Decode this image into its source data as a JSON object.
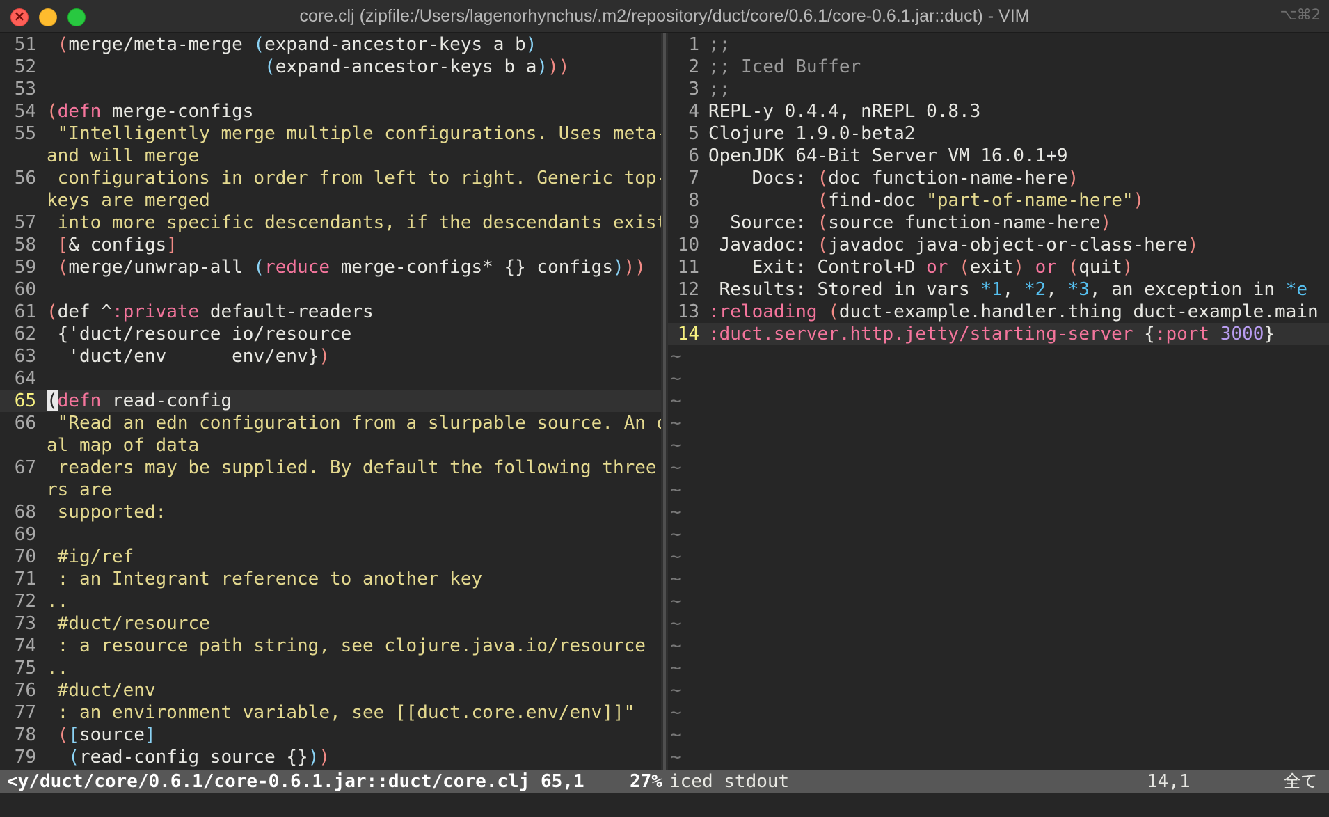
{
  "window": {
    "title": "core.clj (zipfile:/Users/lagenorhynchus/.m2/repository/duct/core/0.6.1/core-0.6.1.jar::duct) - VIM",
    "shortcut": "⌥⌘2"
  },
  "left_pane": {
    "line_numbers": [
      "51",
      "52",
      "53",
      "54",
      "55",
      "",
      "56",
      "",
      "57",
      "58",
      "59",
      "60",
      "61",
      "62",
      "63",
      "64",
      "65",
      "66",
      "",
      "67",
      "",
      "68",
      "69",
      "70",
      "71",
      "72",
      "73",
      "74",
      "75",
      "76",
      "77",
      "78",
      "79"
    ],
    "current_line": "65"
  },
  "right_pane": {
    "line_numbers": [
      "1",
      "2",
      "3",
      "4",
      "5",
      "6",
      "7",
      "8",
      "9",
      "10",
      "11",
      "12",
      "13",
      "14"
    ],
    "current_line": "14",
    "lines": {
      "l4": "REPL-y 0.4.4, nREPL 0.8.3",
      "l5": "Clojure 1.9.0-beta2",
      "l6": "OpenJDK 64-Bit Server VM 16.0.1+9",
      "l7_label": "    Docs: ",
      "l8_pad": "          ",
      "l9_label": "  Source: ",
      "l10_label": " Javadoc: ",
      "l11_label": "    Exit: ",
      "l11_a": "Control+D ",
      "l12_label": " Results: ",
      "l12_a": "Stored in vars ",
      "l12_b": ", an exception in "
    },
    "tilde": "~"
  },
  "status": {
    "left_file": "<y/duct/core/0.6.1/core-0.6.1.jar::duct/core.clj 65,1",
    "left_percent": "27%",
    "right_buffer": "iced_stdout",
    "right_position": "14,1",
    "right_encoding": "全て"
  }
}
